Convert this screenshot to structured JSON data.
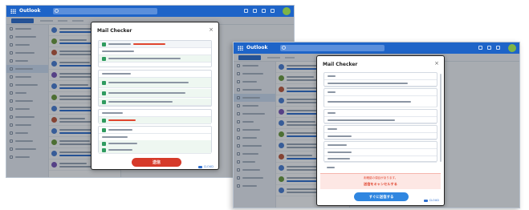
{
  "colors": {
    "brand_blue": "#1e64c8",
    "accent_blue": "#2f6fcf",
    "send_red": "#d63a2a",
    "send_blue": "#2f86e0",
    "check_green": "#2f9b5f",
    "warn_text": "#e0452f",
    "warn_bg": "#fde7e4"
  },
  "left_window": {
    "app_title": "Outlook",
    "search_placeholder": "検索",
    "new_mail_label": "新規メール",
    "dialog": {
      "title": "Mail Checker",
      "send_button_label": "送信",
      "brand_label": "CLOUD"
    }
  },
  "right_window": {
    "app_title": "Outlook",
    "search_placeholder": "検索",
    "new_mail_label": "新規メール",
    "dialog": {
      "title": "Mail Checker",
      "warning_line1": "未確認の項目があります。",
      "warning_line2": "送信をキャンセルする",
      "send_button_label": "すぐに送信する",
      "brand_label": "CLOUD"
    }
  },
  "icons": [
    "waffle-icon",
    "search-icon",
    "close-icon",
    "check-icon",
    "avatar"
  ]
}
